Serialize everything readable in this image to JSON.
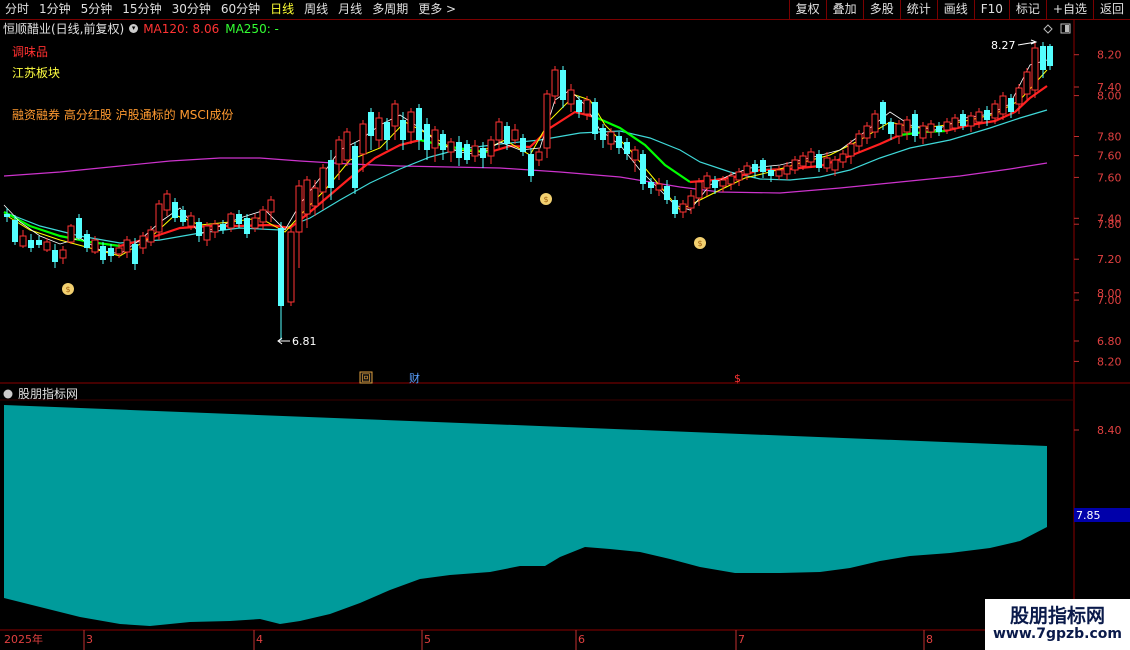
{
  "toolbar": {
    "periods": [
      "分时",
      "1分钟",
      "5分钟",
      "15分钟",
      "30分钟",
      "60分钟",
      "日线",
      "周线",
      "月线",
      "多周期",
      "更多 >"
    ],
    "active_period": "日线",
    "tools": [
      "复权",
      "叠加",
      "多股",
      "统计",
      "画线",
      "F10",
      "标记",
      "+自选",
      "返回"
    ]
  },
  "info": {
    "stock": "恒顺醋业(日线,前复权)",
    "ma120": "MA120: 8.06",
    "ma250": "MA250: -"
  },
  "tags": {
    "sector1": "调味品",
    "sector2": "江苏板块",
    "concepts": "融资融券 高分红股 沪股通标的 MSCI成份"
  },
  "price_axis": [
    "8.20",
    "8.00",
    "7.80",
    "7.60",
    "7.40",
    "7.20",
    "7.00",
    "6.80"
  ],
  "indicator_axis": [
    "8.40",
    "8.20",
    "8.00",
    "7.80",
    "7.60",
    "7.40"
  ],
  "indicator": {
    "name": "股朋指标网",
    "current_value": "7.85"
  },
  "annotations": {
    "high": "8.27",
    "low": "6.81",
    "event1": "回",
    "event2": "财",
    "event3": "$"
  },
  "date_axis": [
    "2025年",
    "3",
    "4",
    "5",
    "6",
    "7",
    "8"
  ],
  "watermark": {
    "line1": "股朋指标网",
    "line2": "www.7gpzb.com"
  },
  "colors": {
    "up": "#ff3333",
    "down": "#54ffff",
    "ma_white": "#ffffff",
    "ma_yellow": "#ffff00",
    "ma_green": "#00ff00",
    "ma_cyan": "#3fd8d8",
    "ma_magenta": "#cc33cc",
    "fill": "#009b9b"
  }
}
